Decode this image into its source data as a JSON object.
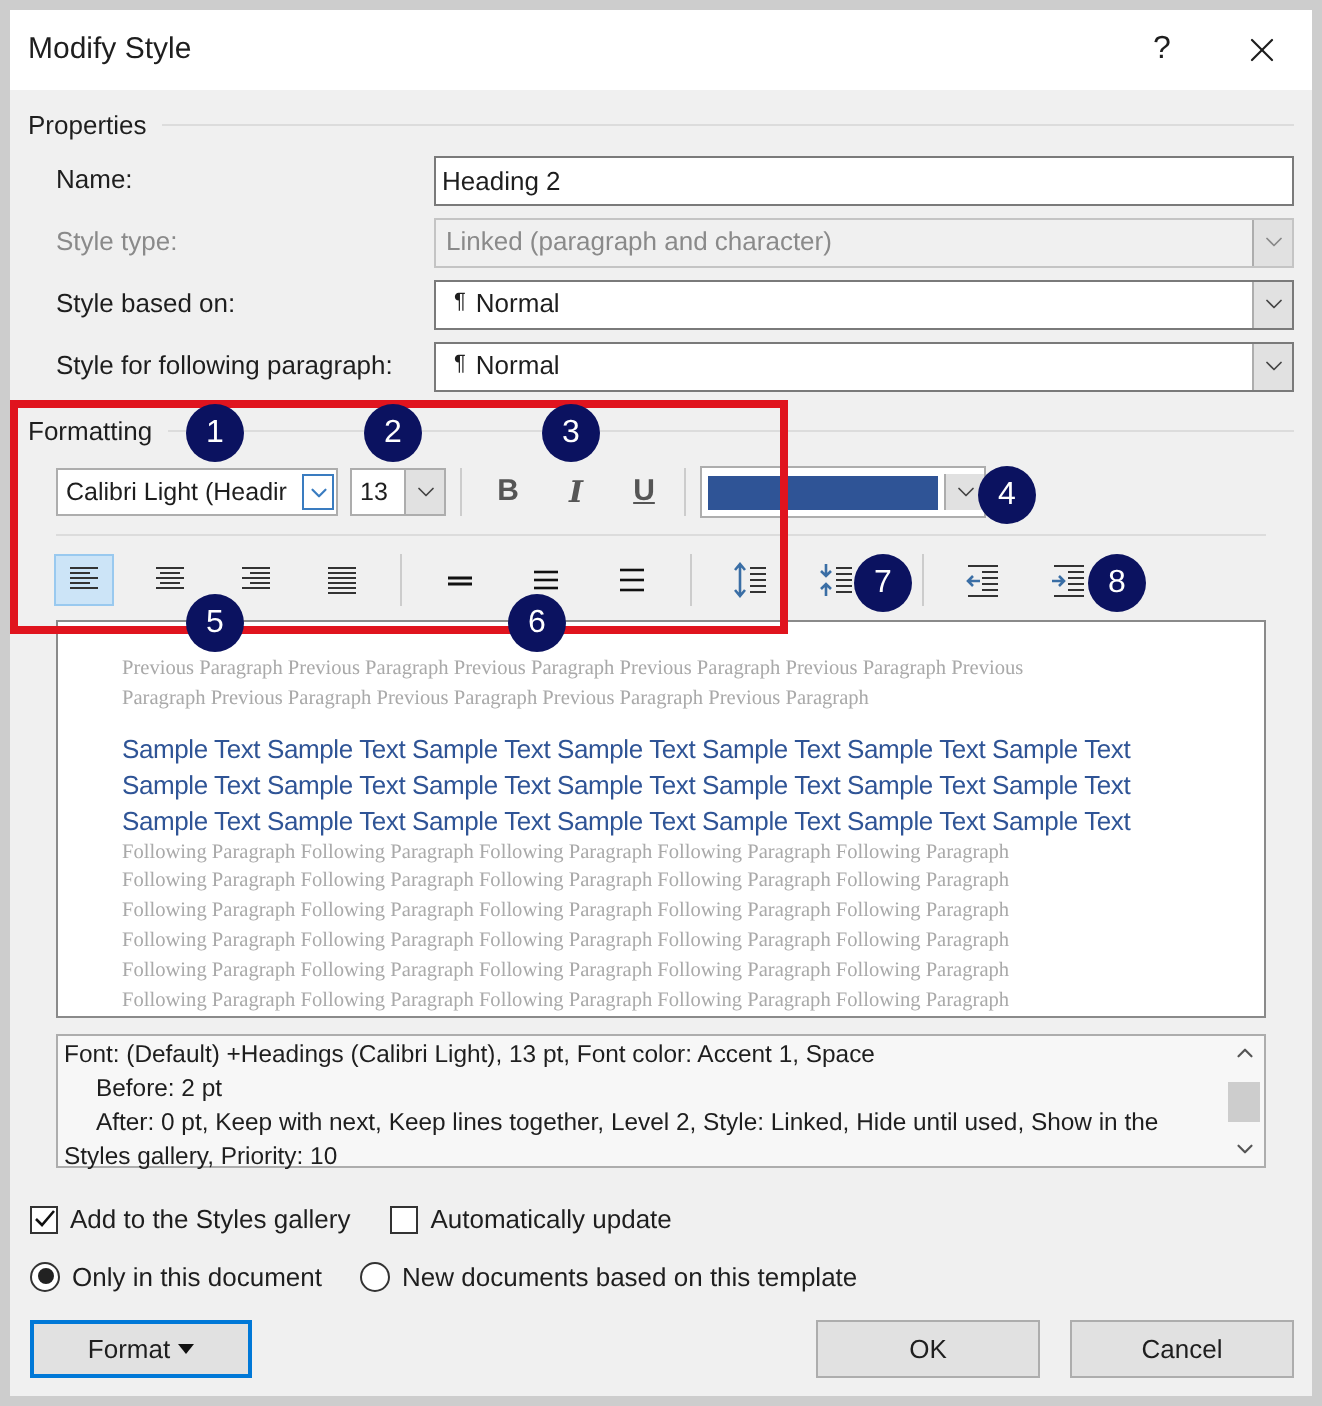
{
  "window": {
    "title": "Modify Style",
    "help": "?"
  },
  "properties": {
    "legend": "Properties",
    "fields": [
      {
        "label": "Name:",
        "value": "Heading 2",
        "kind": "text",
        "disabled": false
      },
      {
        "label": "Style type:",
        "value": "Linked (paragraph and character)",
        "kind": "select",
        "disabled": true
      },
      {
        "label": "Style based on:",
        "value": "Normal",
        "mark": "¶",
        "kind": "select",
        "disabled": false
      },
      {
        "label": "Style for following paragraph:",
        "value": "Normal",
        "mark": "¶",
        "kind": "select",
        "disabled": false
      }
    ]
  },
  "formatting": {
    "legend": "Formatting",
    "font": "Calibri Light (Headir",
    "size": "13",
    "styles": [
      {
        "label": "B",
        "kind": "bold"
      },
      {
        "label": "I",
        "kind": "italic"
      },
      {
        "label": "U",
        "kind": "underline"
      }
    ],
    "color_swatch": {
      "color": "#2f5496"
    },
    "paragraph_tool_groups": [
      [
        {
          "kind": "align-left",
          "selected": true
        },
        {
          "kind": "align-center",
          "selected": false
        },
        {
          "kind": "align-right",
          "selected": false
        },
        {
          "kind": "justify",
          "selected": false
        }
      ],
      [
        {
          "kind": "single-spacing",
          "selected": false
        },
        {
          "kind": "one-half-spacing",
          "selected": false
        },
        {
          "kind": "double-spacing",
          "selected": false
        }
      ],
      [
        {
          "kind": "space-more",
          "selected": false
        },
        {
          "kind": "space-less",
          "selected": false
        }
      ],
      [
        {
          "kind": "outdent",
          "selected": false
        },
        {
          "kind": "indent",
          "selected": false
        }
      ]
    ]
  },
  "preview": {
    "previous": [
      "Previous Paragraph Previous Paragraph Previous Paragraph Previous Paragraph Previous Paragraph Previous",
      "Paragraph Previous Paragraph Previous Paragraph Previous Paragraph Previous Paragraph"
    ],
    "sample": [
      "Sample Text Sample Text Sample Text Sample Text Sample Text Sample Text Sample Text",
      "Sample Text Sample Text Sample Text Sample Text Sample Text Sample Text Sample Text",
      "Sample Text Sample Text Sample Text Sample Text Sample Text Sample Text Sample Text"
    ],
    "following": [
      "Following Paragraph Following Paragraph Following Paragraph Following Paragraph Following Paragraph",
      "Following Paragraph Following Paragraph Following Paragraph Following Paragraph Following Paragraph",
      "Following Paragraph Following Paragraph Following Paragraph Following Paragraph Following Paragraph",
      "Following Paragraph Following Paragraph Following Paragraph Following Paragraph Following Paragraph",
      "Following Paragraph Following Paragraph Following Paragraph Following Paragraph Following Paragraph",
      "Following Paragraph Following Paragraph Following Paragraph Following Paragraph Following Paragraph"
    ]
  },
  "description": [
    "Font: (Default) +Headings (Calibri Light), 13 pt, Font color: Accent 1, Space",
    "Before:  2 pt",
    "After:  0 pt, Keep with next, Keep lines together, Level 2, Style: Linked, Hide until used, Show in the",
    "Styles gallery, Priority: 10"
  ],
  "checkboxes": [
    {
      "label": "Add to the Styles gallery",
      "checked": true
    },
    {
      "label": "Automatically update",
      "checked": false
    }
  ],
  "radios": [
    {
      "label": "Only in this document",
      "selected": true
    },
    {
      "label": "New documents based on this template",
      "selected": false
    }
  ],
  "buttons": {
    "format": "Format",
    "ok": "OK",
    "cancel": "Cancel"
  },
  "callouts": [
    "1",
    "2",
    "3",
    "4",
    "5",
    "6",
    "7",
    "8"
  ]
}
